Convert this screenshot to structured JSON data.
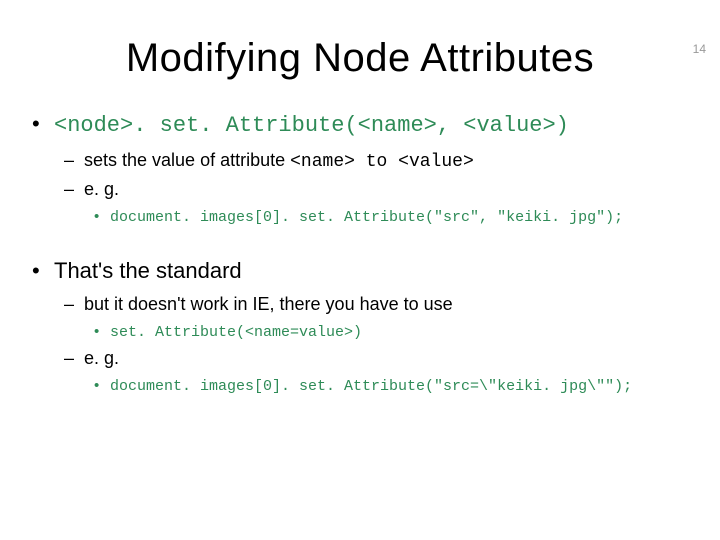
{
  "page_number": "14",
  "title": "Modifying Node  Attributes",
  "bullets": [
    {
      "main_code": "<node>. set. Attribute(<name>, <value>)",
      "subs": [
        {
          "text_before": "sets the value of attribute ",
          "code_part": "<name> to <value>",
          "text_after": ""
        },
        {
          "text_before": "e. g.",
          "code_part": "",
          "text_after": "",
          "subcode": "document. images[0]. set. Attribute(\"src\", \"keiki. jpg\");"
        }
      ]
    },
    {
      "main_text": "That's the standard",
      "subs": [
        {
          "text_before": "but it doesn't work in IE,  there you have to use",
          "subcode_green": "set. Attribute(<name=value>)"
        },
        {
          "text_before": "e. g.",
          "subcode": "document. images[0]. set. Attribute(\"src=\\\"keiki. jpg\\\"\");"
        }
      ]
    }
  ]
}
